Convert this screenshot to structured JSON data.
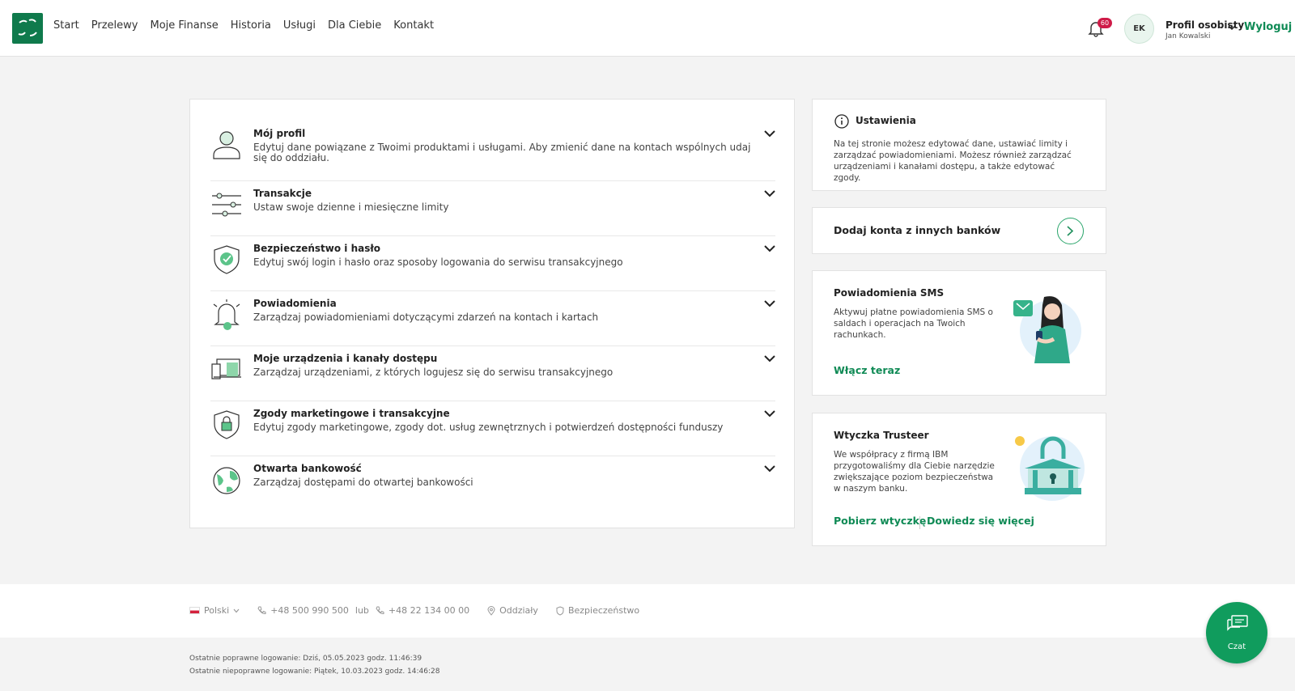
{
  "header": {
    "logo": "bank-logo",
    "nav": [
      "Start",
      "Przelewy",
      "Moje Finanse",
      "Historia",
      "Usługi",
      "Dla Ciebie",
      "Kontakt"
    ],
    "notifications_count": "60",
    "avatar_initials": "EK",
    "profile_name": "Profil osobisty",
    "profile_user": "Jan Kowalski",
    "logout": "Wyloguj"
  },
  "settings": [
    {
      "icon": "profile-icon",
      "title": "Mój profil",
      "desc": "Edytuj dane powiązane z Twoimi produktami i usługami. Aby zmienić dane na kontach wspólnych udaj się do oddziału."
    },
    {
      "icon": "sliders-icon",
      "title": "Transakcje",
      "desc": "Ustaw swoje dzienne i miesięczne limity"
    },
    {
      "icon": "shield-icon",
      "title": "Bezpieczeństwo i hasło",
      "desc": "Edytuj swój login i hasło oraz sposoby logowania do serwisu transakcyjnego"
    },
    {
      "icon": "bell-icon",
      "title": "Powiadomienia",
      "desc": "Zarządzaj powiadomieniami dotyczącymi zdarzeń na kontach i kartach"
    },
    {
      "icon": "devices-icon",
      "title": "Moje urządzenia i kanały dostępu",
      "desc": "Zarządzaj urządzeniami, z których logujesz się do serwisu transakcyjnego"
    },
    {
      "icon": "lock-shield-icon",
      "title": "Zgody marketingowe i transakcyjne",
      "desc": "Edytuj zgody marketingowe, zgody dot. usług zewnętrznych i potwierdzeń dostępności funduszy"
    },
    {
      "icon": "globe-icon",
      "title": "Otwarta bankowość",
      "desc": "Zarządzaj dostępami do otwartej bankowości"
    }
  ],
  "info": {
    "title": "Ustawienia",
    "text": "Na tej stronie możesz edytować dane, ustawiać limity i zarządzać powiadomieniami. Możesz również zarządzać urządzeniami i kanałami dostępu, a także edytować zgody."
  },
  "add_accounts": {
    "title": "Dodaj konta z innych banków"
  },
  "sms": {
    "title": "Powiadomienia SMS",
    "text": "Aktywuj płatne powiadomienia SMS o saldach i operacjach na Twoich rachunkach.",
    "link": "Włącz teraz"
  },
  "trusteer": {
    "title": "Wtyczka Trusteer",
    "text": "We współpracy z firmą IBM przygotowaliśmy dla Ciebie narzędzie zwiększające poziom bezpieczeństwa w naszym banku.",
    "link1": "Pobierz wtyczkę",
    "link2": "Dowiedz się więcej"
  },
  "footer": {
    "language": "Polski",
    "phone1": "+48 500 990 500",
    "or": "lub",
    "phone2": "+48 22 134 00 00",
    "branches": "Oddziały",
    "security": "Bezpieczeństwo",
    "last_ok": "Ostatnie poprawne logowanie: Dziś, 05.05.2023 godz. 11:46:39",
    "last_fail": "Ostatnie niepoprawne logowanie: Piątek, 10.03.2023 godz. 14:46:28"
  },
  "chat": {
    "label": "Czat"
  },
  "colors": {
    "brand": "#0f7a4c",
    "accent": "#0f8a55",
    "badge": "#cf1b48"
  }
}
